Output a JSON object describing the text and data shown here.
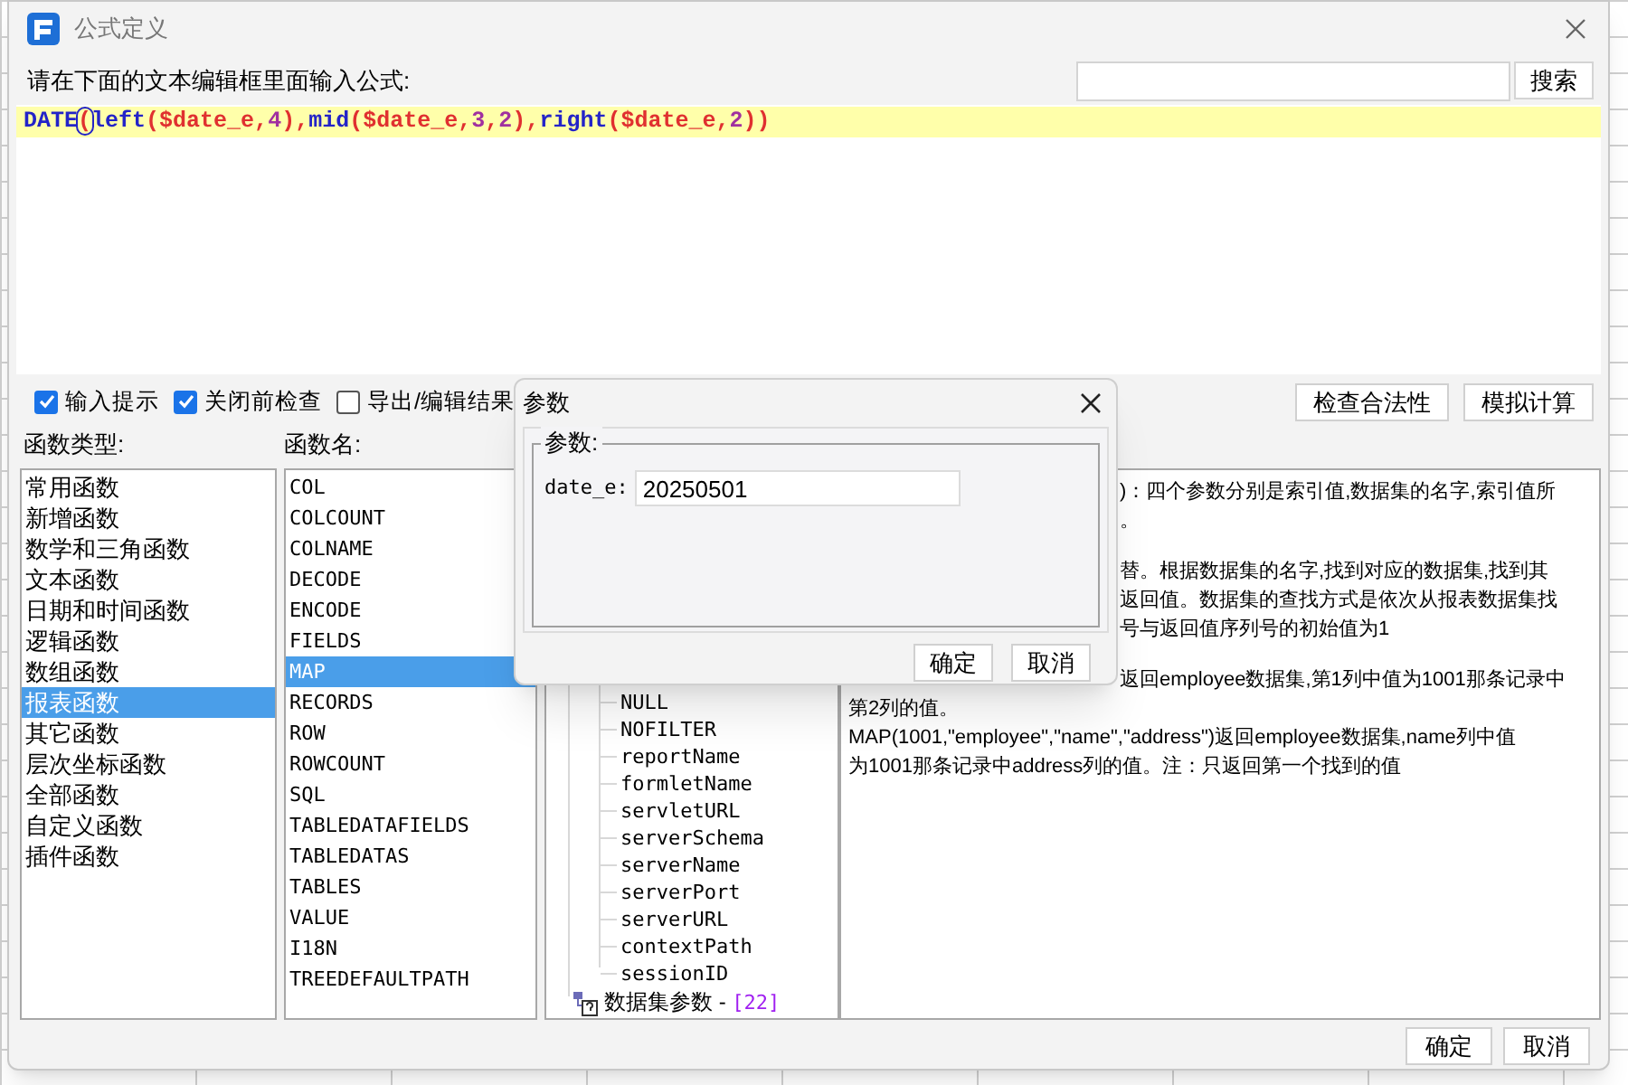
{
  "window": {
    "title": "公式定义"
  },
  "prompt": "请在下面的文本编辑框里面输入公式:",
  "search": {
    "button": "搜索"
  },
  "formula": [
    {
      "text": "DATE",
      "kind": "fn"
    },
    {
      "text": "(",
      "kind": "matched"
    },
    {
      "text": "left",
      "kind": "fn"
    },
    {
      "text": "($date_e,",
      "kind": "sym"
    },
    {
      "text": "4",
      "kind": "num"
    },
    {
      "text": "),",
      "kind": "sym"
    },
    {
      "text": "mid",
      "kind": "fn"
    },
    {
      "text": "($date_e,",
      "kind": "sym"
    },
    {
      "text": "3",
      "kind": "num"
    },
    {
      "text": ",",
      "kind": "sym"
    },
    {
      "text": "2",
      "kind": "num"
    },
    {
      "text": "),",
      "kind": "sym"
    },
    {
      "text": "right",
      "kind": "fn"
    },
    {
      "text": "($date_e,",
      "kind": "sym"
    },
    {
      "text": "2",
      "kind": "num"
    },
    {
      "text": "))",
      "kind": "sym"
    }
  ],
  "options": [
    {
      "label": "输入提示",
      "checked": true
    },
    {
      "label": "关闭前检查",
      "checked": true
    },
    {
      "label": "导出/编辑结果",
      "checked": false
    }
  ],
  "actions": [
    "检查合法性",
    "模拟计算"
  ],
  "function_types": {
    "label": "函数类型:",
    "items": [
      {
        "label": "常用函数",
        "selected": false
      },
      {
        "label": "新增函数",
        "selected": false
      },
      {
        "label": "数学和三角函数",
        "selected": false
      },
      {
        "label": "文本函数",
        "selected": false
      },
      {
        "label": "日期和时间函数",
        "selected": false
      },
      {
        "label": "逻辑函数",
        "selected": false
      },
      {
        "label": "数组函数",
        "selected": false
      },
      {
        "label": "报表函数",
        "selected": true
      },
      {
        "label": "其它函数",
        "selected": false
      },
      {
        "label": "层次坐标函数",
        "selected": false
      },
      {
        "label": "全部函数",
        "selected": false
      },
      {
        "label": "自定义函数",
        "selected": false
      },
      {
        "label": "插件函数",
        "selected": false
      }
    ]
  },
  "function_names": {
    "label": "函数名:",
    "items": [
      {
        "label": "COL",
        "selected": false
      },
      {
        "label": "COLCOUNT",
        "selected": false
      },
      {
        "label": "COLNAME",
        "selected": false
      },
      {
        "label": "DECODE",
        "selected": false
      },
      {
        "label": "ENCODE",
        "selected": false
      },
      {
        "label": "FIELDS",
        "selected": false
      },
      {
        "label": "MAP",
        "selected": true
      },
      {
        "label": "RECORDS",
        "selected": false
      },
      {
        "label": "ROW",
        "selected": false
      },
      {
        "label": "ROWCOUNT",
        "selected": false
      },
      {
        "label": "SQL",
        "selected": false
      },
      {
        "label": "TABLEDATAFIELDS",
        "selected": false
      },
      {
        "label": "TABLEDATAS",
        "selected": false
      },
      {
        "label": "TABLES",
        "selected": false
      },
      {
        "label": "VALUE",
        "selected": false
      },
      {
        "label": "I18N",
        "selected": false
      },
      {
        "label": "TREEDEFAULTPATH",
        "selected": false
      }
    ]
  },
  "tree": {
    "leaves": [
      "NULL",
      "NOFILTER",
      "reportName",
      "formletName",
      "servletURL",
      "serverSchema",
      "serverName",
      "serverPort",
      "serverURL",
      "contextPath",
      "sessionID"
    ],
    "nodes": [
      {
        "label": "数据集参数 - ",
        "count": "[22]"
      }
    ]
  },
  "description": [
    {
      "lines": [
        {
          "text": ")：四个参数分别是索引值,数据集的名字,索引值所",
          "clipped": true
        },
        {
          "text": "。",
          "clipped": true
        }
      ]
    },
    {
      "lines": [
        {
          "text": "替。根据数据集的名字,找到对应的数据集,找到其",
          "clipped": true
        },
        {
          "text": "返回值。数据集的查找方式是依次从报表数据集找",
          "clipped": true
        },
        {
          "text": "号与返回值序列号的初始值为1",
          "clipped": true
        }
      ]
    },
    {
      "lines": [
        {
          "text": "返回employee数据集,第1列中值为1001那条记录中",
          "clipped": true
        },
        {
          "text": "第2列的值。",
          "clipped": false
        },
        {
          "text": "MAP(1001,\"employee\",\"name\",\"address\")返回employee数据集,name列中值",
          "clipped": false
        },
        {
          "text": "为1001那条记录中address列的值。注：只返回第一个找到的值",
          "clipped": false
        }
      ]
    }
  ],
  "buttons": [
    "确定",
    "取消"
  ],
  "param_dialog": {
    "title": "参数",
    "group": "参数:",
    "fields": [
      {
        "label": "date_e:",
        "value": "20250501"
      }
    ],
    "buttons": [
      "确定",
      "取消"
    ]
  }
}
